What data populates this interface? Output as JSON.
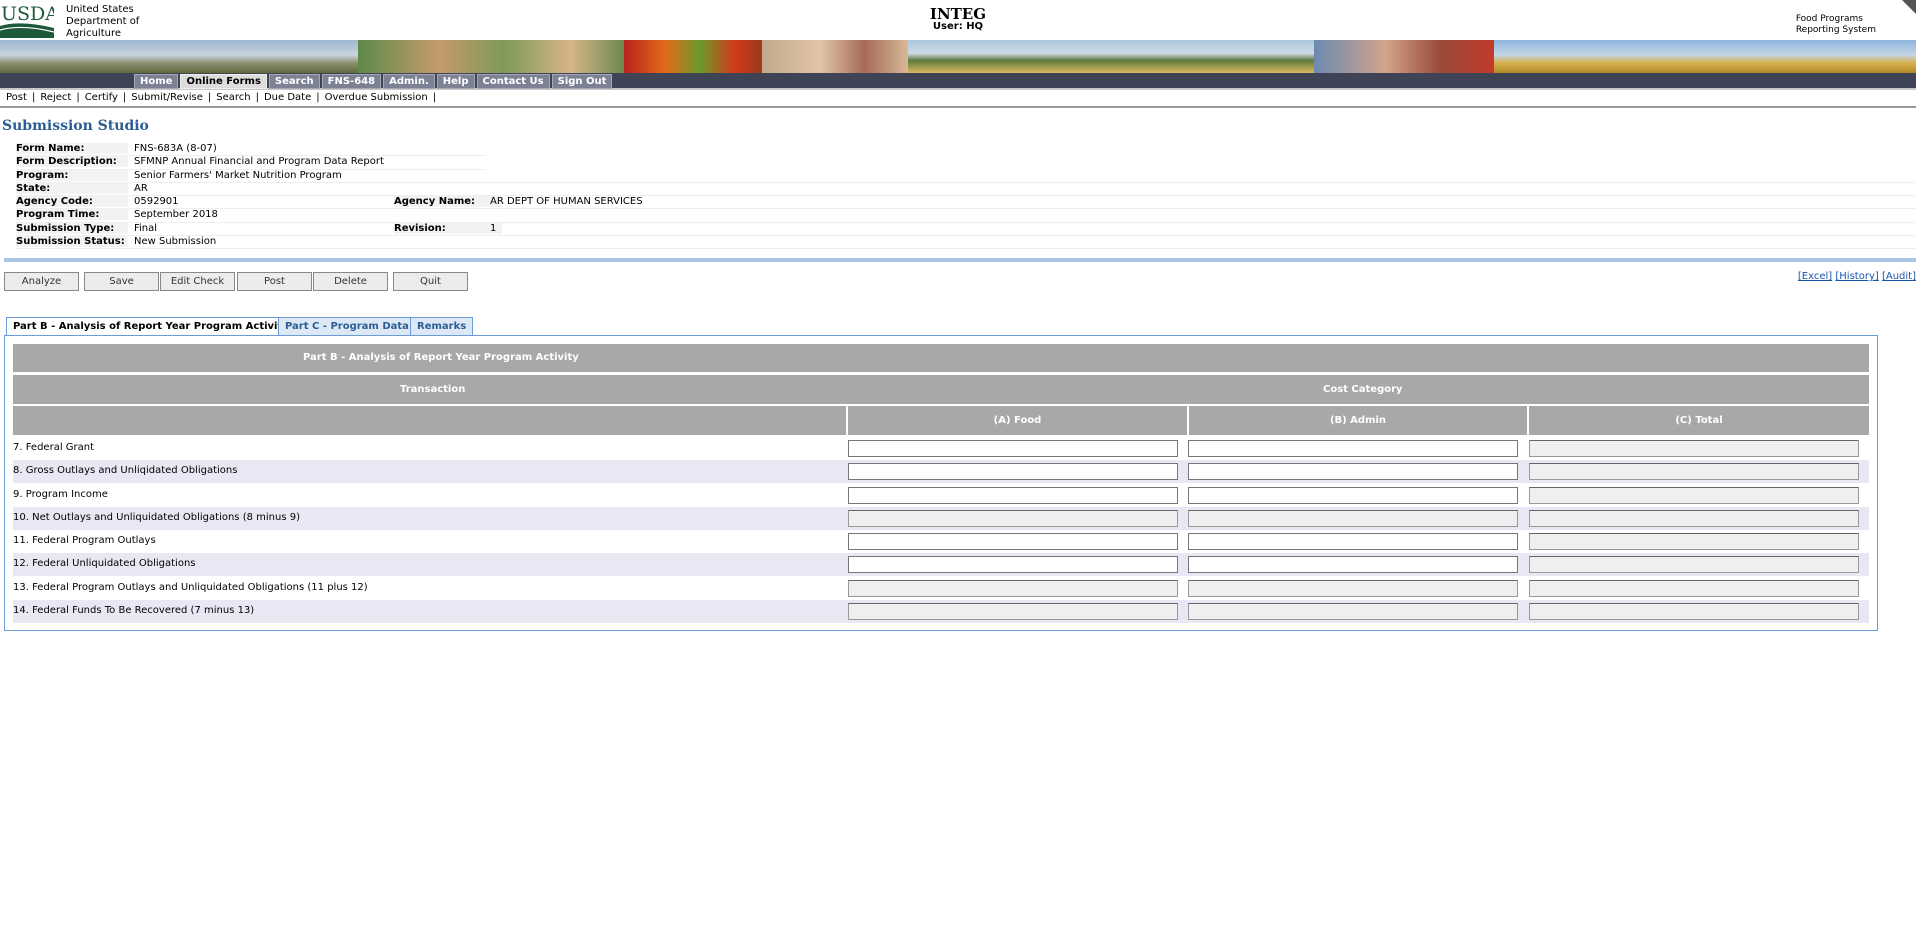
{
  "header": {
    "logo_text": "USDA",
    "agency_line1": "United States",
    "agency_line2": "Department of",
    "agency_line3": "Agriculture",
    "environment": "INTEG",
    "user": "User: HQ",
    "system_line1": "Food Programs",
    "system_line2": "Reporting System"
  },
  "nav": {
    "items": [
      "Home",
      "Online Forms",
      "Search",
      "FNS-648",
      "Admin.",
      "Help",
      "Contact Us",
      "Sign Out"
    ],
    "active": "Online Forms"
  },
  "submenu": {
    "items": [
      "Post",
      "Reject",
      "Certify",
      "Submit/Revise",
      "Search",
      "Due Date",
      "Overdue Submission"
    ]
  },
  "page_title": "Submission Studio",
  "info": {
    "form_name_label": "Form Name:",
    "form_name": "FNS-683A (8-07)",
    "form_desc_label": "Form Description:",
    "form_desc": "SFMNP Annual Financial and Program Data Report",
    "program_label": "Program:",
    "program": "Senior Farmers' Market Nutrition Program",
    "state_label": "State:",
    "state": "AR",
    "agency_code_label": "Agency Code:",
    "agency_code": "0592901",
    "agency_name_label": "Agency Name:",
    "agency_name": "AR DEPT OF HUMAN SERVICES",
    "program_time_label": "Program Time:",
    "program_time": "September 2018",
    "submission_type_label": "Submission Type:",
    "submission_type": "Final",
    "revision_label": "Revision:",
    "revision": "1",
    "submission_status_label": "Submission Status:",
    "submission_status": "New Submission"
  },
  "buttons": {
    "analyze": "Analyze",
    "save": "Save",
    "edit_check": "Edit Check",
    "post": "Post",
    "delete": "Delete",
    "quit": "Quit"
  },
  "links": {
    "excel": "[Excel]",
    "history": "[History]",
    "audit": "[Audit]"
  },
  "tabs": [
    "Part B - Analysis of Report Year Program Activity",
    "Part C - Program Data",
    "Remarks"
  ],
  "grid": {
    "title": "Part B - Analysis of Report Year Program Activity",
    "transaction_header": "Transaction",
    "cost_category_header": "Cost Category",
    "col_food": "(A) Food",
    "col_admin": "(B) Admin",
    "col_total": "(C) Total",
    "rows": [
      {
        "label": "7. Federal Grant",
        "food": "",
        "admin": "",
        "total": ""
      },
      {
        "label": "8. Gross Outlays and Unliqidated Obligations",
        "food": "",
        "admin": "",
        "total": ""
      },
      {
        "label": "9. Program Income",
        "food": "",
        "admin": "",
        "total": ""
      },
      {
        "label": "10. Net Outlays and Unliquidated Obligations (8 minus 9)",
        "food": "",
        "admin": "",
        "total": ""
      },
      {
        "label": "11. Federal Program Outlays",
        "food": "",
        "admin": "",
        "total": ""
      },
      {
        "label": "12. Federal Unliquidated Obligations",
        "food": "",
        "admin": "",
        "total": ""
      },
      {
        "label": "13. Federal Program Outlays and Unliquidated Obligations (11 plus 12)",
        "food": "",
        "admin": "",
        "total": ""
      },
      {
        "label": "14. Federal Funds To Be Recovered (7 minus 13)",
        "food": "",
        "admin": "",
        "total": ""
      }
    ]
  },
  "colors": {
    "nav_bg": "#3e4355",
    "title_blue": "#2c5e94",
    "grid_header": "#a8a8a8",
    "alt_row": "#e8e8f5"
  }
}
